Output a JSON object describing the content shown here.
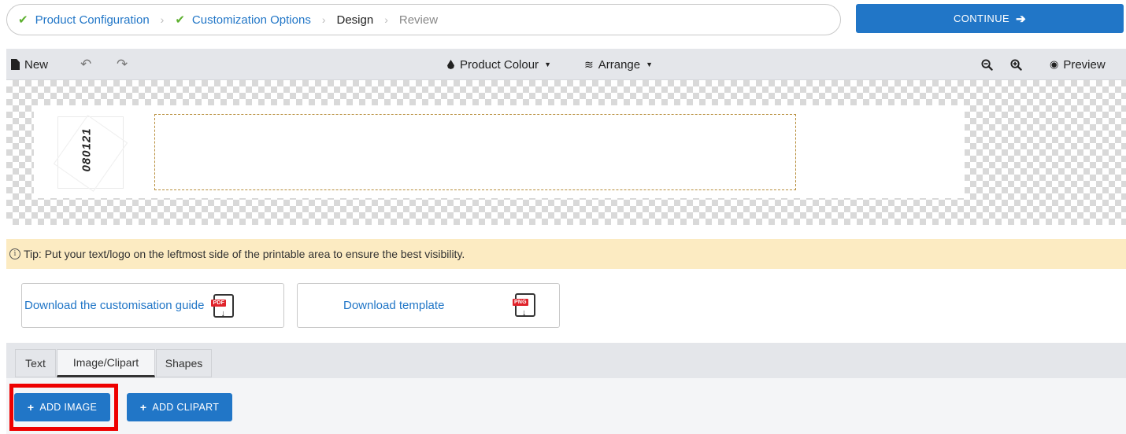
{
  "stepper": {
    "steps": [
      {
        "label": "Product Configuration",
        "state": "done"
      },
      {
        "label": "Customization Options",
        "state": "done"
      },
      {
        "label": "Design",
        "state": "current"
      },
      {
        "label": "Review",
        "state": "pending"
      }
    ],
    "continue_label": "CONTINUE"
  },
  "toolbar": {
    "new_label": "New",
    "product_colour_label": "Product Colour",
    "arrange_label": "Arrange",
    "preview_label": "Preview",
    "icons": [
      "file-icon",
      "undo-icon",
      "redo-icon",
      "drop-icon",
      "layers-icon",
      "zoom-out-icon",
      "zoom-in-icon",
      "eye-icon"
    ]
  },
  "canvas": {
    "serial_number": "080121"
  },
  "tip": {
    "text": "Tip: Put your text/logo on the leftmost side of the printable area to ensure the best visibility."
  },
  "downloads": {
    "guide_label": "Download the customisation guide",
    "guide_badge": "PDF",
    "template_label": "Download template",
    "template_badge": "PNG"
  },
  "tabs": [
    {
      "label": "Text",
      "active": false
    },
    {
      "label": "Image/Clipart",
      "active": true
    },
    {
      "label": "Shapes",
      "active": false
    }
  ],
  "actions": {
    "add_image_label": "ADD IMAGE",
    "add_clipart_label": "ADD CLIPART"
  },
  "colors": {
    "accent": "#2176c7",
    "check": "#5db02f",
    "tip_bg": "#fcebc2",
    "highlight": "#ee0000"
  }
}
